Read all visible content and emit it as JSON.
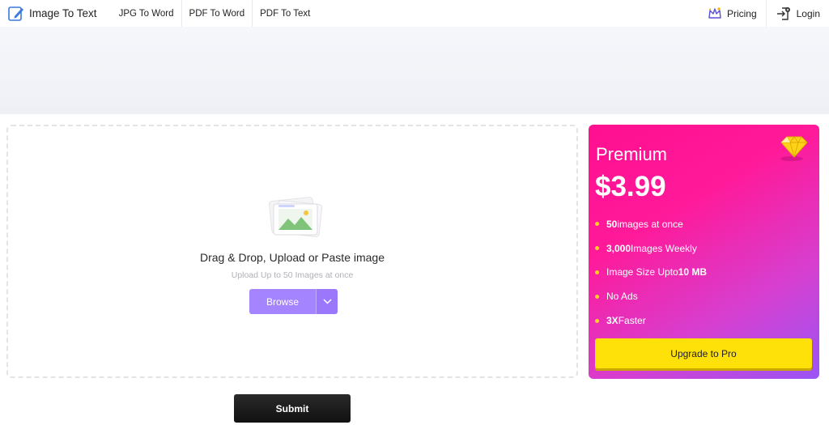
{
  "header": {
    "brand_label": "Image To Text",
    "nav": [
      {
        "label": "JPG To Word"
      },
      {
        "label": "PDF To Word"
      },
      {
        "label": "PDF To Text"
      }
    ],
    "pricing_label": "Pricing",
    "login_label": "Login"
  },
  "dropzone": {
    "title": "Drag & Drop, Upload or Paste image",
    "subtitle": "Upload Up to 50 Images at once",
    "browse_label": "Browse"
  },
  "premium": {
    "title": "Premium",
    "price": "$3.99",
    "features": [
      {
        "bold": "50",
        "text": " images at once"
      },
      {
        "bold": "3,000",
        "text": " Images Weekly"
      },
      {
        "pre": "Image Size Upto ",
        "bold": "10 MB",
        "text": ""
      },
      {
        "pre": "No Ads",
        "bold": "",
        "text": ""
      },
      {
        "bold": "3X",
        "text": " Faster"
      }
    ],
    "upgrade_label": "Upgrade to Pro"
  },
  "submit_label": "Submit",
  "colors": {
    "accent_purple": "#a584ff",
    "premium_pink": "#ff0f8f",
    "upgrade_yellow": "#ffe10a",
    "submit_dark": "#1c1c1c"
  },
  "icons": [
    "pen-notepad-icon",
    "crown-icon",
    "login-arrow-icon",
    "image-upload-icon",
    "chevron-down-icon",
    "diamond-icon"
  ]
}
